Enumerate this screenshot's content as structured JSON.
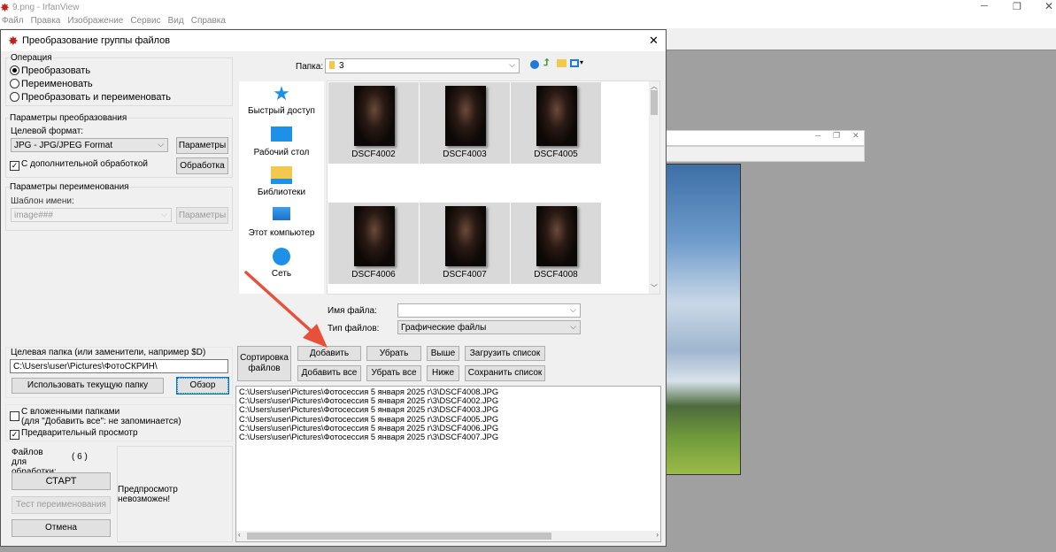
{
  "app": {
    "title": "9.png - IrfanView",
    "menu": [
      "Файл",
      "Правка",
      "Изображение",
      "Сервис",
      "Вид",
      "Справка"
    ]
  },
  "dialog": {
    "title": "Преобразование группы файлов",
    "operation": {
      "label": "Операция",
      "options": [
        "Преобразовать",
        "Переименовать",
        "Преобразовать и переименовать"
      ],
      "selected": 0
    },
    "convert": {
      "label": "Параметры преобразования",
      "format_label": "Целевой формат:",
      "format_value": "JPG - JPG/JPEG Format",
      "params_button": "Параметры",
      "extra_processing": "С дополнительной обработкой",
      "extra_checked": true,
      "processing_button": "Обработка"
    },
    "rename": {
      "label": "Параметры переименования",
      "template_label": "Шаблон имени:",
      "template_value": "image###",
      "params_button": "Параметры"
    },
    "target": {
      "label": "Целевая папка (или заменители, например $D)",
      "value": "C:\\Users\\user\\Pictures\\ФотоСКРИН\\",
      "use_current_button": "Использовать текущую папку",
      "browse_button": "Обзор"
    },
    "options": {
      "subfolders": "С вложенными папками",
      "subfolders_note": "(для \"Добавить все\": не запоминается)",
      "subfolders_checked": false,
      "preview": "Предварительный просмотр",
      "preview_checked": true
    },
    "files_label": "Файлов для обработки:",
    "files_count": "( 6 )",
    "start_button": "СТАРТ",
    "test_button": "Тест переименования",
    "cancel_button": "Отмена",
    "preview_text": "Предпросмотр невозможен!",
    "folder_label": "Папка:",
    "folder_value": "3",
    "places": [
      "Быстрый доступ",
      "Рабочий стол",
      "Библиотеки",
      "Этот компьютер",
      "Сеть"
    ],
    "thumbnails": [
      "DSCF4002",
      "DSCF4003",
      "DSCF4005",
      "DSCF4006",
      "DSCF4007",
      "DSCF4008"
    ],
    "filename_label": "Имя файла:",
    "filename_value": "",
    "filetype_label": "Тип файлов:",
    "filetype_value": "Графические файлы",
    "buttons": {
      "sort": "Сортировка файлов",
      "add": "Добавить",
      "add_all": "Добавить все",
      "remove": "Убрать",
      "remove_all": "Убрать все",
      "up": "Выше",
      "down": "Ниже",
      "load": "Загрузить список",
      "save": "Сохранить список"
    },
    "file_list": [
      "C:\\Users\\user\\Pictures\\Фотосессия 5 января 2025 г\\3\\DSCF4008.JPG",
      "C:\\Users\\user\\Pictures\\Фотосессия 5 января 2025 г\\3\\DSCF4002.JPG",
      "C:\\Users\\user\\Pictures\\Фотосессия 5 января 2025 г\\3\\DSCF4003.JPG",
      "C:\\Users\\user\\Pictures\\Фотосессия 5 января 2025 г\\3\\DSCF4005.JPG",
      "C:\\Users\\user\\Pictures\\Фотосессия 5 января 2025 г\\3\\DSCF4006.JPG",
      "C:\\Users\\user\\Pictures\\Фотосессия 5 января 2025 г\\3\\DSCF4007.JPG"
    ]
  },
  "colors": {
    "arrow": "#e8503a",
    "accent": "#0078d7"
  }
}
